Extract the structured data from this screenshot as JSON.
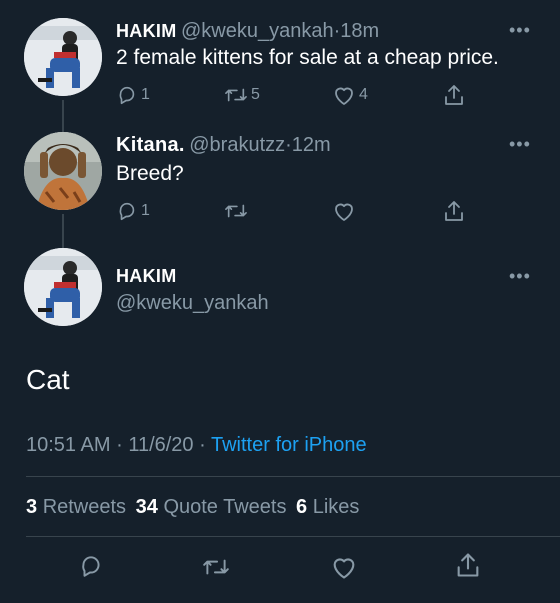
{
  "thread": [
    {
      "display_name": "HAKIM",
      "handle": "@kweku_yankah",
      "separator": "·",
      "time": "18m",
      "text": "2 female kittens for sale at a cheap price.",
      "replies": "1",
      "retweets": "5",
      "likes": "4"
    },
    {
      "display_name": "Kitana.",
      "handle": "@brakutzz",
      "separator": "·",
      "time": "12m",
      "text": "Breed?",
      "replies": "1",
      "retweets": "",
      "likes": ""
    }
  ],
  "main_tweet": {
    "display_name": "HAKIM",
    "handle": "@kweku_yankah",
    "text": "Cat",
    "time": "10:51 AM",
    "separator": "·",
    "date": "11/6/20",
    "separator2": "·",
    "source": "Twitter for iPhone",
    "retweets_count": "3",
    "retweets_label": "Retweets",
    "quotes_count": "34",
    "quotes_label": "Quote Tweets",
    "likes_count": "6",
    "likes_label": "Likes"
  },
  "more_glyph": "•••",
  "colors": {
    "background": "#15202b",
    "secondary_text": "#8899a6",
    "link": "#1da1f2",
    "divider": "#38444d"
  }
}
